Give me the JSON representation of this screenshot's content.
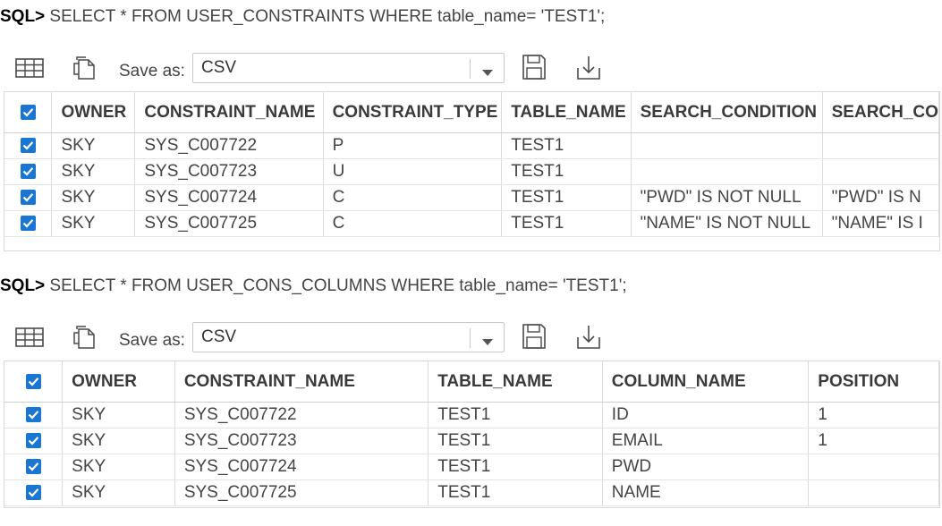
{
  "query1": {
    "prompt": "SQL>",
    "text": " SELECT * FROM USER_CONSTRAINTS WHERE table_name= 'TEST1';",
    "toolbar": {
      "grid_icon": "grid-view-icon",
      "copy_icon": "copy-icon",
      "save_as_label": "Save as:",
      "format": "CSV",
      "save_icon": "floppy-disk-icon",
      "download_icon": "download-icon"
    },
    "columns": [
      "OWNER",
      "CONSTRAINT_NAME",
      "CONSTRAINT_TYPE",
      "TABLE_NAME",
      "SEARCH_CONDITION",
      "SEARCH_CO"
    ],
    "rows": [
      [
        "SKY",
        "SYS_C007722",
        "P",
        "TEST1",
        "",
        ""
      ],
      [
        "SKY",
        "SYS_C007723",
        "U",
        "TEST1",
        "",
        ""
      ],
      [
        "SKY",
        "SYS_C007724",
        "C",
        "TEST1",
        "\"PWD\" IS NOT NULL",
        "\"PWD\" IS N"
      ],
      [
        "SKY",
        "SYS_C007725",
        "C",
        "TEST1",
        "\"NAME\" IS NOT NULL",
        "\"NAME\" IS I"
      ]
    ]
  },
  "query2": {
    "prompt": "SQL>",
    "text": " SELECT * FROM USER_CONS_COLUMNS WHERE table_name= 'TEST1';",
    "toolbar": {
      "grid_icon": "grid-view-icon",
      "copy_icon": "copy-icon",
      "save_as_label": "Save as:",
      "format": "CSV",
      "save_icon": "floppy-disk-icon",
      "download_icon": "download-icon"
    },
    "columns": [
      "OWNER",
      "CONSTRAINT_NAME",
      "TABLE_NAME",
      "COLUMN_NAME",
      "POSITION"
    ],
    "rows": [
      [
        "SKY",
        "SYS_C007722",
        "TEST1",
        "ID",
        "1"
      ],
      [
        "SKY",
        "SYS_C007723",
        "TEST1",
        "EMAIL",
        "1"
      ],
      [
        "SKY",
        "SYS_C007724",
        "TEST1",
        "PWD",
        ""
      ],
      [
        "SKY",
        "SYS_C007725",
        "TEST1",
        "NAME",
        ""
      ]
    ]
  },
  "colors": {
    "accent": "#1976d2",
    "border": "#d9d9d9",
    "text": "#444444"
  }
}
